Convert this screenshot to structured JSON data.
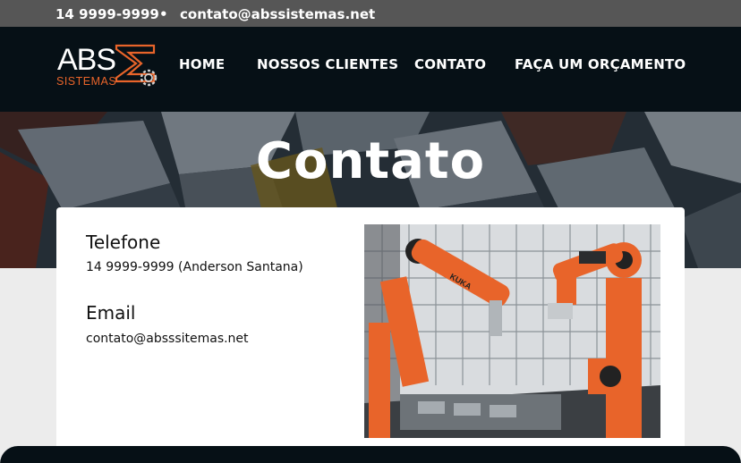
{
  "topbar": {
    "phone": "14 9999-9999",
    "separator": "•",
    "email": "contato@abssistemas.net"
  },
  "logo": {
    "text_top": "ABS",
    "text_bottom": "SISTEMAS"
  },
  "nav": {
    "items": [
      {
        "label": "HOME"
      },
      {
        "label": "NOSSOS CLIENTES"
      },
      {
        "label": "CONTATO"
      },
      {
        "label": "FAÇA UM ORÇAMENTO"
      }
    ]
  },
  "hero": {
    "title": "Contato"
  },
  "contact": {
    "phone_heading": "Telefone",
    "phone_value": "14 9999-9999 (Anderson Santana)",
    "email_heading": "Email",
    "email_value": "contato@absssitemas.net"
  },
  "photo": {
    "label": "KUKA"
  },
  "colors": {
    "brand_orange": "#e8642a",
    "nav_bg": "#061016",
    "topbar_bg": "#565656"
  }
}
